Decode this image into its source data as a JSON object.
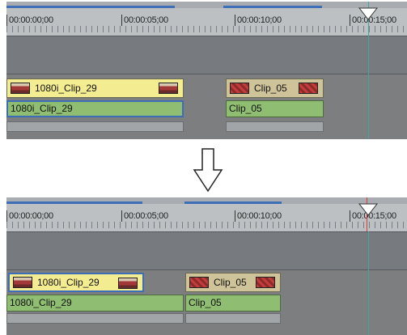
{
  "ruler": {
    "timecodes": [
      "00:00:00;00",
      "00:00:05;00",
      "00:00:10;00",
      "00:00:15;00"
    ]
  },
  "before": {
    "clip1": {
      "title": "1080i_Clip_29",
      "video_label": "1080i_Clip_29"
    },
    "clip2": {
      "title": "Clip_05",
      "video_label": "Clip_05"
    }
  },
  "after": {
    "clip1": {
      "title": "1080i_Clip_29",
      "video_label": "1080i_Clip_29"
    },
    "clip2": {
      "title": "Clip_05",
      "video_label": "Clip_05"
    }
  },
  "colors": {
    "ruler_bg": "#bcc0c3",
    "track_bg": "#7d7e80",
    "title_yellow": "#f4ec91",
    "title_tan": "#cfc399",
    "video_green": "#8fbd72",
    "selection_blue": "#3d6db5",
    "cursor_teal": "#3fa9a1",
    "cursor_red": "#e03b3b"
  },
  "icons": {
    "transition_arrow": "down-arrow-icon",
    "timeline_cursor": "timeline-cursor-icon",
    "clip_thumbnail": "clip-thumbnail-icon"
  }
}
